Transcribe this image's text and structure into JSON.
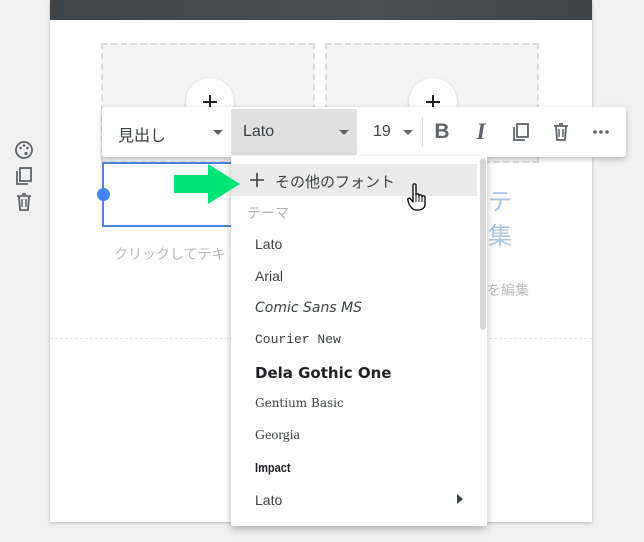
{
  "canvas": {
    "placeholder_left": "クリックしてテキ",
    "placeholder_right": "を編集",
    "faded_text_line1": "テ",
    "faded_text_line2": "集"
  },
  "side_tools": {
    "icons": [
      "palette-icon",
      "copy-icon",
      "trash-icon"
    ]
  },
  "toolbar": {
    "style_label": "見出し",
    "font_label": "Lato",
    "size_label": "19",
    "bold_label": "B",
    "italic_label": "I",
    "icons": [
      "duplicate-icon",
      "delete-icon",
      "more-icon"
    ]
  },
  "font_menu": {
    "more_fonts_label": "その他のフォント",
    "section_label": "テーマ",
    "items": [
      {
        "label": "Lato"
      },
      {
        "label": "Arial"
      },
      {
        "label": "Comic Sans MS"
      },
      {
        "label": "Courier New"
      },
      {
        "label": "Dela Gothic One"
      },
      {
        "label": "Gentium Basic"
      },
      {
        "label": "Georgia"
      },
      {
        "label": "Impact"
      },
      {
        "label": "Lato"
      }
    ]
  },
  "colors": {
    "accent_blue": "#4285f4",
    "arrow_green": "#00e676"
  }
}
